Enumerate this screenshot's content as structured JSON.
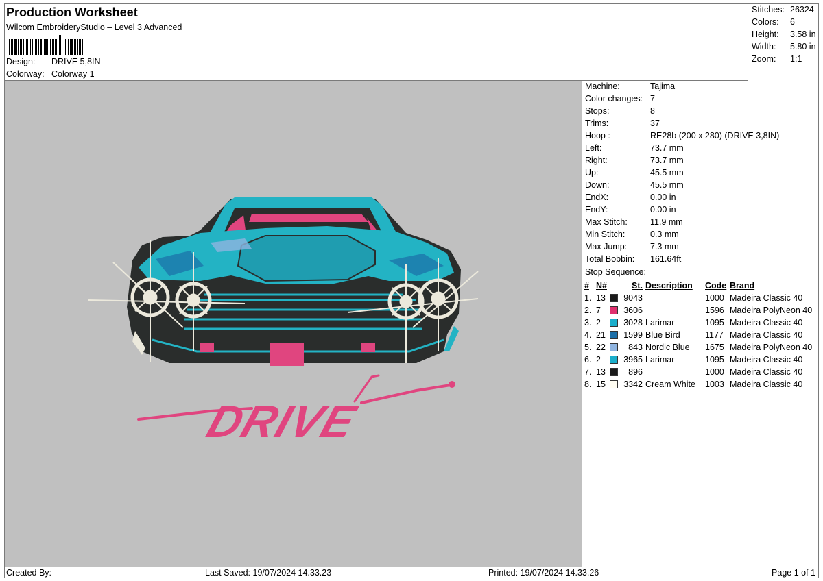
{
  "header": {
    "title": "Production Worksheet",
    "subtitle": "Wilcom EmbroideryStudio – Level 3 Advanced",
    "design_label": "Design:",
    "design_value": "DRIVE 5,8IN",
    "colorway_label": "Colorway:",
    "colorway_value": "Colorway 1"
  },
  "stats": {
    "stitches_label": "Stitches:",
    "stitches_value": "26324",
    "colors_label": "Colors:",
    "colors_value": "6",
    "height_label": "Height:",
    "height_value": "3.58 in",
    "width_label": "Width:",
    "width_value": "5.80 in",
    "zoom_label": "Zoom:",
    "zoom_value": "1:1"
  },
  "info": {
    "machine_label": "Machine:",
    "machine_value": "Tajima",
    "color_changes_label": "Color changes:",
    "color_changes_value": "7",
    "stops_label": "Stops:",
    "stops_value": "8",
    "trims_label": "Trims:",
    "trims_value": "37",
    "hoop_label": "Hoop :",
    "hoop_value": "RE28b (200 x 280) (DRIVE 3,8IN)",
    "left_label": "Left:",
    "left_value": "73.7 mm",
    "right_label": "Right:",
    "right_value": "73.7 mm",
    "up_label": "Up:",
    "up_value": "45.5 mm",
    "down_label": "Down:",
    "down_value": "45.5 mm",
    "endx_label": "EndX:",
    "endx_value": "0.00 in",
    "endy_label": "EndY:",
    "endy_value": "0.00 in",
    "max_stitch_label": "Max Stitch:",
    "max_stitch_value": "11.9 mm",
    "min_stitch_label": "Min Stitch:",
    "min_stitch_value": "0.3 mm",
    "max_jump_label": "Max Jump:",
    "max_jump_value": "7.3 mm",
    "total_bobbin_label": "Total Bobbin:",
    "total_bobbin_value": "161.64ft"
  },
  "sequence": {
    "title": "Stop Sequence:",
    "headers": {
      "num": "#",
      "n": "N#",
      "st": "St.",
      "desc": "Description",
      "code": "Code",
      "brand": "Brand"
    },
    "rows": [
      {
        "num": "1.",
        "n": "13",
        "color": "#1a1a1a",
        "st": "9043",
        "desc": "",
        "code": "1000",
        "brand": "Madeira Classic 40"
      },
      {
        "num": "2.",
        "n": "7",
        "color": "#e0306e",
        "st": "3606",
        "desc": "",
        "code": "1596",
        "brand": "Madeira PolyNeon 40"
      },
      {
        "num": "3.",
        "n": "2",
        "color": "#1aaecb",
        "st": "3028",
        "desc": "Larimar",
        "code": "1095",
        "brand": "Madeira Classic 40"
      },
      {
        "num": "4.",
        "n": "21",
        "color": "#1b6fa8",
        "st": "1599",
        "desc": "Blue Bird",
        "code": "1177",
        "brand": "Madeira Classic 40"
      },
      {
        "num": "5.",
        "n": "22",
        "color": "#8fb4e0",
        "st": "843",
        "desc": "Nordic Blue",
        "code": "1675",
        "brand": "Madeira PolyNeon 40"
      },
      {
        "num": "6.",
        "n": "2",
        "color": "#1aaecb",
        "st": "3965",
        "desc": "Larimar",
        "code": "1095",
        "brand": "Madeira Classic 40"
      },
      {
        "num": "7.",
        "n": "13",
        "color": "#1a1a1a",
        "st": "896",
        "desc": "",
        "code": "1000",
        "brand": "Madeira Classic 40"
      },
      {
        "num": "8.",
        "n": "15",
        "color": "#fffdf2",
        "st": "3342",
        "desc": "Cream White",
        "code": "1003",
        "brand": "Madeira Classic 40"
      }
    ]
  },
  "design": {
    "text": "DRIVE",
    "colors": {
      "body": "#2a2d2c",
      "teal": "#23b3c4",
      "pink": "#e0457f",
      "cream": "#ece9dc",
      "bg": "#c0c0c0"
    }
  },
  "footer": {
    "created_by": "Created By:",
    "last_saved": "Last Saved: 19/07/2024 14.33.23",
    "printed": "Printed: 19/07/2024 14.33.26",
    "page": "Page 1 of 1"
  }
}
